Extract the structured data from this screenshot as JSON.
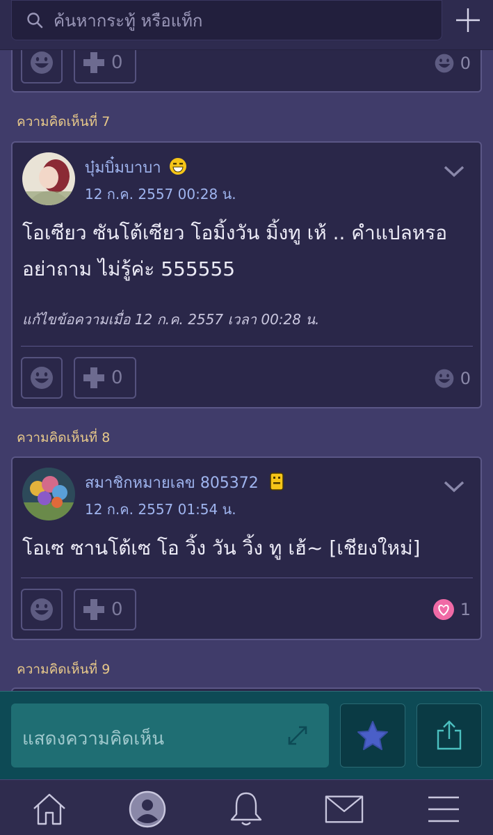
{
  "search": {
    "placeholder": "ค้นหากระทู้ หรือแท็ก"
  },
  "top_card": {
    "plus_count": "0",
    "react_count": "0"
  },
  "comments": [
    {
      "label": "ความคิดเห็นที่ 7",
      "author": "บุ๋มบิ๋มบาบา",
      "time": "12 ก.ค. 2557 00:28 น.",
      "body": "โอเซียว ซันโต้เซียว โอมิ้งวัน มิ้งทู เห้ .. คำแปลหรอ อย่าถาม ไม่รู้ค่ะ 555555",
      "edited": "แก้ไขข้อความเมื่อ 12 ก.ค. 2557 เวลา 00:28 น.",
      "plus_count": "0",
      "react_count": "0"
    },
    {
      "label": "ความคิดเห็นที่ 8",
      "author": "สมาชิกหมายเลข 805372",
      "time": "12 ก.ค. 2557 01:54 น.",
      "body": "โอเซ ซานโต้เซ โอ วิ้ง วัน วิ้ง ทู เฮ้~ [เชียงใหม่]",
      "plus_count": "0",
      "react_count": "1"
    },
    {
      "label": "ความคิดเห็นที่ 9"
    }
  ],
  "comment_bar": {
    "placeholder": "แสดงความคิดเห็น"
  },
  "icons": {
    "search": "search-icon",
    "add": "plus-icon",
    "smile": "smile-icon",
    "plus": "plus-icon",
    "chevron": "chevron-down-icon",
    "heart": "heart-icon",
    "star": "star-icon",
    "share": "share-icon",
    "expand": "expand-icon",
    "home": "home-icon",
    "profile": "user-icon",
    "bell": "bell-icon",
    "mail": "mail-icon",
    "menu": "menu-icon"
  },
  "colors": {
    "accent_label": "#e8c98a",
    "name_blue": "#9fb4ee",
    "teal_bar": "#0d4a55",
    "heart_pink": "#f06aa6"
  }
}
